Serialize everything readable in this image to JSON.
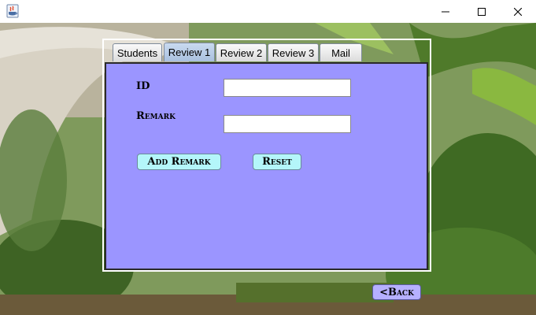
{
  "window": {
    "icon": "java-cup-icon",
    "controls": {
      "minimize": "minimize-icon",
      "maximize": "maximize-icon",
      "close": "close-icon"
    }
  },
  "tabs": [
    {
      "label": "Students",
      "selected": false
    },
    {
      "label": "Review 1",
      "selected": true
    },
    {
      "label": "Review 2",
      "selected": false
    },
    {
      "label": "Review 3",
      "selected": false
    },
    {
      "label": "Mail",
      "selected": false
    }
  ],
  "form": {
    "id_label": "ID",
    "id_value": "",
    "remark_label": "Remark",
    "remark_value": "",
    "add_remark_label": "Add Remark",
    "reset_label": "Reset"
  },
  "back_label": "<Back",
  "colors": {
    "panel_bg": "#9b95ff",
    "button_bg": "#b4f6fa",
    "back_button_bg": "#b6b0ff",
    "selected_tab": "#a9c0de"
  }
}
